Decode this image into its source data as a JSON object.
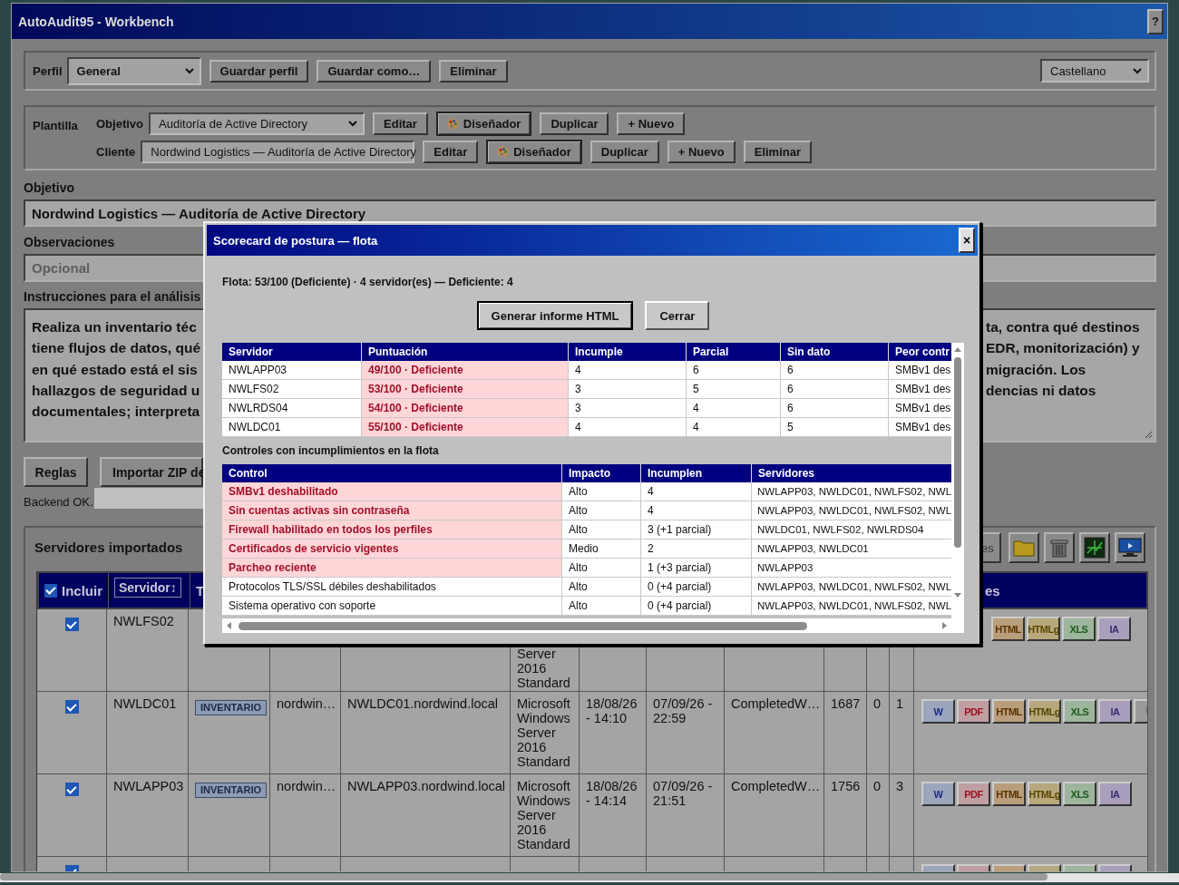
{
  "window": {
    "title": "AutoAudit95 - Workbench",
    "help_button": "?"
  },
  "profile_bar": {
    "label": "Perfil",
    "profile_select": "General",
    "buttons": [
      "Guardar perfil",
      "Guardar como…",
      "Eliminar"
    ],
    "language_select": "Castellano"
  },
  "template_panel": {
    "label": "Plantilla",
    "rows": [
      {
        "label": "Objetivo",
        "select": "Auditoría de Active Directory",
        "buttons": [
          {
            "label": "Editar",
            "kind": "plain"
          },
          {
            "label": "Diseñador",
            "kind": "designer"
          },
          {
            "label": "Duplicar",
            "kind": "plain"
          },
          {
            "label": "+ Nuevo",
            "kind": "plain"
          }
        ]
      },
      {
        "label": "Cliente",
        "select": "Nordwind Logistics — Auditoría de Active Directory",
        "buttons": [
          {
            "label": "Editar",
            "kind": "plain"
          },
          {
            "label": "Diseñador",
            "kind": "designer"
          },
          {
            "label": "Duplicar",
            "kind": "plain"
          },
          {
            "label": "+ Nuevo",
            "kind": "plain"
          },
          {
            "label": "Eliminar",
            "kind": "plain"
          }
        ]
      }
    ]
  },
  "objective": {
    "label": "Objetivo",
    "value": "Nordwind Logistics — Auditoría de Active Directory"
  },
  "observations": {
    "label": "Observaciones",
    "placeholder": "Opcional"
  },
  "instructions": {
    "label": "Instrucciones para el análisis",
    "left_lines": [
      "Realiza un inventario téc",
      "tiene flujos de datos, qué",
      "en qué estado está el sis",
      "hallazgos de seguridad u",
      "documentales; interpreta"
    ],
    "right_lines": [
      "ta, contra qué destinos",
      "EDR, monitorización) y",
      "migración. Los",
      "dencias ni datos"
    ]
  },
  "action_buttons": [
    "Reglas",
    "Importar ZIP de"
  ],
  "status": "Backend OK.",
  "servers_panel": {
    "title": "Servidores importados",
    "toolbar_button": "es",
    "header": {
      "select_all_label": "Incluir",
      "select_all_checked": true,
      "sort_button": "Servidor↕",
      "column_3": "T",
      "column_13": "es"
    },
    "rows": [
      {
        "checked": true,
        "server": "NWLFS02",
        "os": "Server 2016 Standard",
        "actions": [
          {
            "kind": "html",
            "label": "HTML"
          },
          {
            "kind": "htmlg",
            "label": "HTMLg"
          },
          {
            "kind": "xls",
            "label": "XLS"
          },
          {
            "kind": "ia",
            "label": "IA"
          }
        ]
      },
      {
        "checked": true,
        "server": "NWLDC01",
        "type": "INVENTARIO",
        "client": "nordwin…",
        "fqdn": "NWLDC01.nordwind.local",
        "os": "Microsoft Windows Server 2016 Standard",
        "imported": "18/08/26 - 14:10",
        "date": "07/09/26 - 22:59",
        "status": "CompletedW…",
        "column_10": "1687",
        "column_11": "0",
        "column_12": "1",
        "actions": [
          {
            "kind": "w",
            "label": "W"
          },
          {
            "kind": "pdf",
            "label": "PDF"
          },
          {
            "kind": "html",
            "label": "HTML"
          },
          {
            "kind": "htmlg",
            "label": "HTMLg"
          },
          {
            "kind": "xls",
            "label": "XLS"
          },
          {
            "kind": "ia",
            "label": "IA"
          },
          {
            "kind": "more"
          }
        ]
      },
      {
        "checked": true,
        "server": "NWLAPP03",
        "type": "INVENTARIO",
        "client": "nordwin…",
        "fqdn": "NWLAPP03.nordwind.local",
        "os": "Microsoft Windows Server 2016 Standard",
        "imported": "18/08/26 - 14:14",
        "date": "07/09/26 - 21:51",
        "status": "CompletedW…",
        "column_10": "1756",
        "column_11": "0",
        "column_12": "3",
        "actions": [
          {
            "kind": "w",
            "label": "W"
          },
          {
            "kind": "pdf",
            "label": "PDF"
          },
          {
            "kind": "html",
            "label": "HTML"
          },
          {
            "kind": "htmlg",
            "label": "HTMLg"
          },
          {
            "kind": "xls",
            "label": "XLS"
          },
          {
            "kind": "ia",
            "label": "IA"
          }
        ]
      },
      {
        "checked": true,
        "actions": [
          {
            "kind": "w"
          },
          {
            "kind": "pdf"
          },
          {
            "kind": "html"
          },
          {
            "kind": "htmlg"
          },
          {
            "kind": "xls"
          },
          {
            "kind": "ia"
          }
        ]
      }
    ]
  },
  "modal": {
    "title": "Scorecard de postura — flota",
    "close": "×",
    "summary": "Flota: 53/100 (Deficiente) · 4 servidor(es) — Deficiente: 4",
    "buttons": [
      {
        "label": "Generar informe HTML",
        "default": true
      },
      {
        "label": "Cerrar",
        "default": false
      }
    ],
    "servers_table": {
      "columns": [
        "Servidor",
        "Puntuación",
        "Incumple",
        "Parcial",
        "Sin dato",
        "Peor contr"
      ],
      "rows": [
        {
          "server": "NWLAPP03",
          "score": "49/100 · Deficiente",
          "deficient": true,
          "fail": "4",
          "partial": "6",
          "no_data": "6",
          "worst": "SMBv1 des"
        },
        {
          "server": "NWLFS02",
          "score": "53/100 · Deficiente",
          "deficient": true,
          "fail": "3",
          "partial": "5",
          "no_data": "6",
          "worst": "SMBv1 des"
        },
        {
          "server": "NWLRDS04",
          "score": "54/100 · Deficiente",
          "deficient": true,
          "fail": "3",
          "partial": "4",
          "no_data": "6",
          "worst": "SMBv1 des"
        },
        {
          "server": "NWLDC01",
          "score": "55/100 · Deficiente",
          "deficient": true,
          "fail": "4",
          "partial": "4",
          "no_data": "5",
          "worst": "SMBv1 des"
        }
      ]
    },
    "controls_title": "Controles con incumplimientos en la flota",
    "controls_table": {
      "columns": [
        "Control",
        "Impacto",
        "Incumplen",
        "Servidores"
      ],
      "rows": [
        {
          "control": "SMBv1 deshabilitado",
          "failing": true,
          "impact": "Alto",
          "count": "4",
          "servers": "NWLAPP03, NWLDC01, NWLFS02, NWL"
        },
        {
          "control": "Sin cuentas activas sin contraseña",
          "failing": true,
          "impact": "Alto",
          "count": "4",
          "servers": "NWLAPP03, NWLDC01, NWLFS02, NWL"
        },
        {
          "control": "Firewall habilitado en todos los perfiles",
          "failing": true,
          "impact": "Alto",
          "count": "3 (+1 parcial)",
          "servers": "NWLDC01, NWLFS02, NWLRDS04"
        },
        {
          "control": "Certificados de servicio vigentes",
          "failing": true,
          "impact": "Medio",
          "count": "2",
          "servers": "NWLAPP03, NWLDC01"
        },
        {
          "control": "Parcheo reciente",
          "failing": true,
          "impact": "Alto",
          "count": "1 (+3 parcial)",
          "servers": "NWLAPP03"
        },
        {
          "control": "Protocolos TLS/SSL débiles deshabilitados",
          "failing": false,
          "impact": "Alto",
          "count": "0 (+4 parcial)",
          "servers": "NWLAPP03, NWLDC01, NWLFS02, NWL"
        },
        {
          "control": "Sistema operativo con soporte",
          "failing": false,
          "impact": "Alto",
          "count": "0 (+4 parcial)",
          "servers": "NWLAPP03, NWLDC01, NWLFS02, NWL"
        }
      ]
    }
  }
}
